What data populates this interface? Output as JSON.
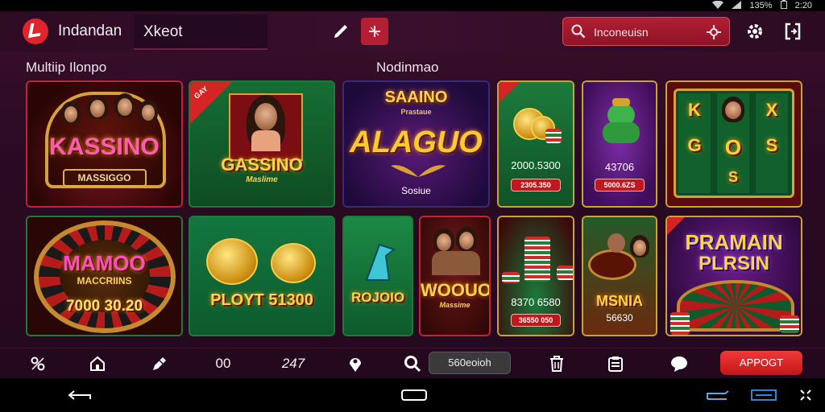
{
  "status": {
    "battery_text": "135%",
    "clock": "2:20"
  },
  "header": {
    "brand": "Indandan",
    "active_tab": "Xkeot",
    "search_value": "Inconeuisn"
  },
  "sections": {
    "left_title": "Multiip Ilonpo",
    "right_title": "Nodinmao"
  },
  "cards": {
    "c1": {
      "title": "KASSINO",
      "pill": "MASSIGGO"
    },
    "c2": {
      "corner": "GAY",
      "title": "GASSINO",
      "sub": "Maslime"
    },
    "c3": {
      "top": "SAAINO",
      "sub_top": "Prastaue",
      "title": "ALAGUO",
      "caption": "Sosiue"
    },
    "c4": {
      "amount": "2000.5300",
      "pill": "2305.350"
    },
    "c5": {
      "amount": "43706",
      "pill": "5000.6ZS"
    },
    "c6": {
      "reels": [
        "K",
        "X",
        "O",
        "S",
        "G",
        "S"
      ]
    },
    "c7": {
      "title": "MAMOO",
      "sub": "MACCRIINS",
      "amount": "7000 30.20"
    },
    "c8": {
      "amount": "PLOYT 51300"
    },
    "c9": {
      "amount": "ROJOIO"
    },
    "c10": {
      "title": "WOOUO",
      "sub": "Massime"
    },
    "c11": {
      "amount": "8370 6580",
      "pill": "36550 050"
    },
    "c12": {
      "title": "MSNIA",
      "amount": "56630"
    },
    "c13": {
      "title": "PRAMAIN",
      "sub": "PLRSIN"
    }
  },
  "navbar": {
    "count_a": "00",
    "count_b": "247",
    "pill_label": "560eoioh",
    "approve_label": "APPOGT"
  },
  "colors": {
    "accent_red": "#e0242b",
    "bg_plum": "#2a0a22"
  }
}
